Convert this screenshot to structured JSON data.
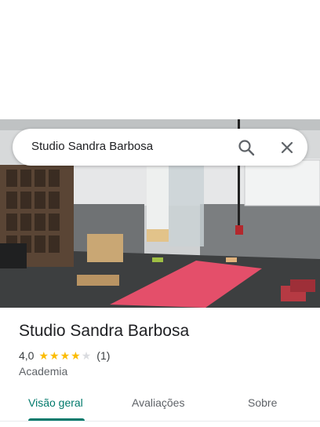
{
  "search": {
    "query": "Studio Sandra Barbosa"
  },
  "place": {
    "title": "Studio Sandra Barbosa",
    "rating": "4,0",
    "stars_filled": 4,
    "stars_total": 5,
    "review_count": "(1)",
    "category": "Academia"
  },
  "tabs": [
    {
      "label": "Visão geral",
      "active": true
    },
    {
      "label": "Avaliações",
      "active": false
    },
    {
      "label": "Sobre",
      "active": false
    }
  ],
  "colors": {
    "accent": "#00796b",
    "star": "#fbbc04",
    "star_empty": "#dadce0"
  },
  "icons": {
    "search": "search-icon",
    "close": "close-icon"
  }
}
